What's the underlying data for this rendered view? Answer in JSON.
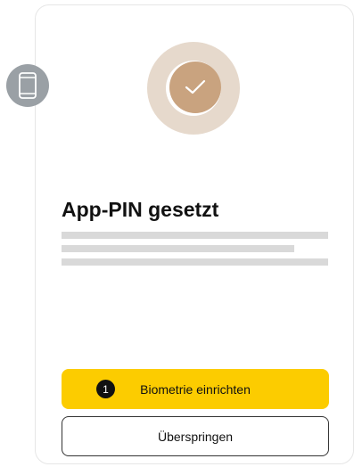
{
  "screen": {
    "title": "App-PIN gesetzt"
  },
  "icons": {
    "device": "smartphone-icon",
    "status": "checkmark-icon"
  },
  "step_marker": {
    "number": "1"
  },
  "actions": {
    "primary_label": "Biometrie einrichten",
    "secondary_label": "Überspringen"
  },
  "colors": {
    "primary_button": "#fccc00",
    "device_badge": "#9aa0a5",
    "success_halo": "#e6d9cc",
    "success_fill": "#c9a37f",
    "placeholder_text": "#d9d9d9"
  }
}
